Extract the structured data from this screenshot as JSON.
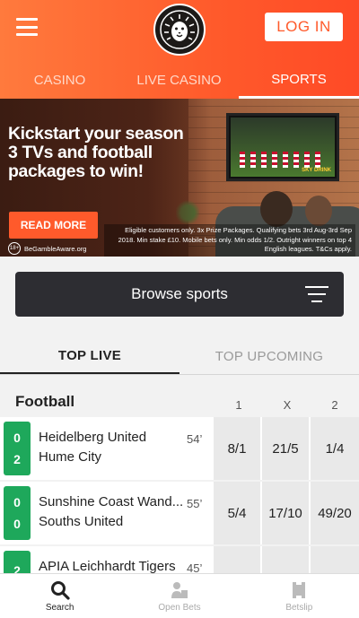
{
  "header": {
    "login_label": "LOG IN",
    "nav": [
      "CASINO",
      "LIVE CASINO",
      "SPORTS"
    ],
    "active_nav": "SPORTS",
    "accent_color": "#ff5a2b"
  },
  "banner": {
    "headline_line1": "Kickstart your season",
    "headline_line2": "3 TVs and football",
    "headline_line3": "packages to win!",
    "read_more": "READ MORE",
    "age_badge": "18+",
    "gamble_aware": "BeGambleAware.org",
    "terms": "Eligible customers only. 3x Prize Packages. Qualifying bets 3rd Aug-3rd Sep 2018. Min stake £10. Mobile bets only. Min odds 1/2. Outright winners on top 4 English leagues. T&Cs apply.",
    "tv_brand": "SKY DRINK"
  },
  "browse": {
    "label": "Browse sports"
  },
  "tabs": [
    "TOP LIVE",
    "TOP UPCOMING"
  ],
  "active_tab": "TOP LIVE",
  "football": {
    "title": "Football",
    "columns": [
      "1",
      "X",
      "2"
    ],
    "matches": [
      {
        "home": "Heidelberg United",
        "away": "Hume City",
        "home_score": "0",
        "away_score": "2",
        "minute": "54’",
        "odds": [
          "8/1",
          "21/5",
          "1/4"
        ]
      },
      {
        "home": "Sunshine Coast Wand...",
        "away": "Souths United",
        "home_score": "0",
        "away_score": "0",
        "minute": "55’",
        "odds": [
          "5/4",
          "17/10",
          "49/20"
        ]
      },
      {
        "home": "APIA Leichhardt Tigers",
        "away": "",
        "home_score": "2",
        "away_score": "",
        "minute": "45’",
        "odds": [
          "",
          "",
          ""
        ]
      }
    ]
  },
  "bottom_nav": [
    "Search",
    "Open Bets",
    "Betslip"
  ],
  "active_bottom": "Search"
}
